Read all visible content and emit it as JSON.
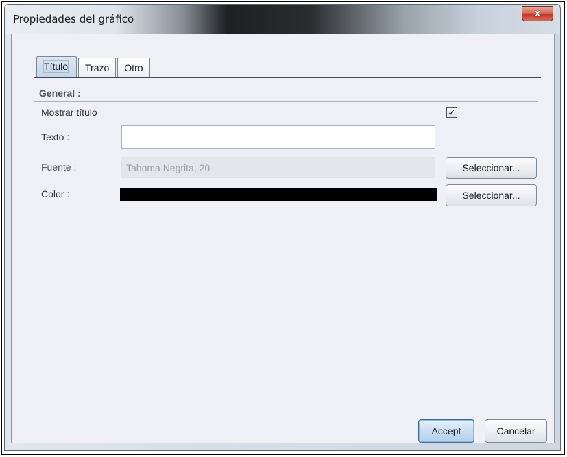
{
  "window": {
    "title": "Propiedades del gráfico",
    "close_glyph": "x"
  },
  "tabs": [
    {
      "label": "Título",
      "selected": true
    },
    {
      "label": "Trazo",
      "selected": false
    },
    {
      "label": "Otro",
      "selected": false
    }
  ],
  "general": {
    "title": "General :",
    "show_title_label": "Mostrar título",
    "show_title_checked": true,
    "check_glyph": "✓",
    "text_label": "Texto :",
    "text_value": "",
    "font_label": "Fuente :",
    "font_value": "Tahoma Negrita, 20",
    "font_select_label": "Seleccionar...",
    "color_label": "Color :",
    "color_value": "#000000",
    "color_select_label": "Seleccionar..."
  },
  "footer": {
    "accept_label": "Accept",
    "cancel_label": "Cancelar"
  }
}
